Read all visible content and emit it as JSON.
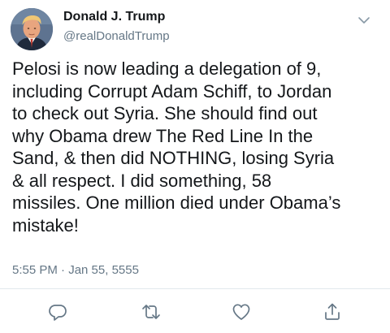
{
  "author": {
    "name": "Donald J. Trump",
    "handle": "@realDonaldTrump",
    "avatar_icon": "profile-photo"
  },
  "tweet": {
    "text": "Pelosi is now leading a delegation of 9,\nincluding Corrupt Adam Schiff, to Jordan\nto check out Syria. She should find out\nwhy Obama drew The Red Line In the\nSand, & then did NOTHING, losing Syria\n& all respect. I did something, 58\nmissiles. One million died under Obama’s\nmistake!",
    "timestamp": "5:55 PM · Jan 55, 5555"
  },
  "actions": {
    "icons": [
      "reply-icon",
      "retweet-icon",
      "like-icon",
      "share-icon"
    ]
  },
  "colors": {
    "text": "#14171a",
    "secondary": "#657786",
    "divider": "#e1e8ed"
  }
}
